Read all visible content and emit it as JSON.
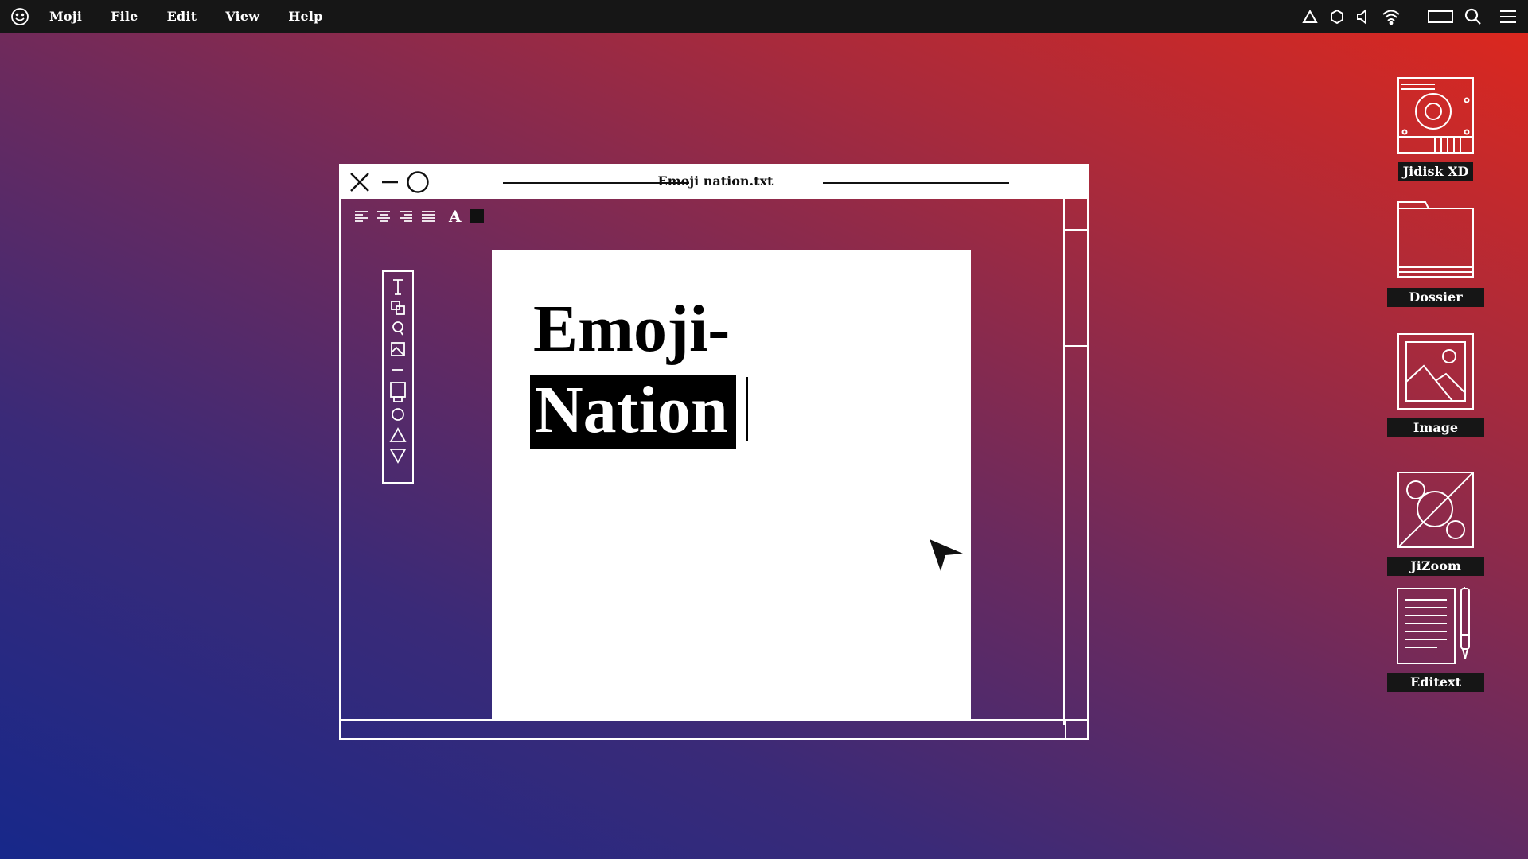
{
  "menubar": {
    "logo_icon": "smiley-icon",
    "items": [
      {
        "label": "Moji"
      },
      {
        "label": "File"
      },
      {
        "label": "Edit"
      },
      {
        "label": "View"
      },
      {
        "label": "Help"
      }
    ],
    "status_icons": [
      "triangle-icon",
      "hexagon-icon",
      "speaker-icon",
      "wifi-icon",
      "battery-icon",
      "search-icon",
      "hamburger-menu-icon"
    ]
  },
  "window": {
    "title": "Emoji nation.txt",
    "controls": [
      "close-icon",
      "minimize-icon",
      "maximize-icon"
    ],
    "format_bar": {
      "align_icons": [
        "align-left-icon",
        "align-center-icon",
        "align-right-icon",
        "align-justify-icon"
      ],
      "font_label": "A",
      "text_color": "#111111"
    },
    "tools": [
      "text-tool-icon",
      "layers-tool-icon",
      "lasso-tool-icon",
      "image-tool-icon",
      "line-tool-icon",
      "rectangle-tool-icon",
      "circle-tool-icon",
      "triangle-tool-icon",
      "inverted-triangle-tool-icon"
    ],
    "document": {
      "line1": "Emoji-",
      "line2_selected": "Nation"
    }
  },
  "desktop_icons": [
    {
      "label": "Jidisk XD",
      "icon": "hard-disk-icon"
    },
    {
      "label": "Dossier",
      "icon": "folder-icon"
    },
    {
      "label": "Image",
      "icon": "image-icon"
    },
    {
      "label": "JiZoom",
      "icon": "zoom-app-icon"
    },
    {
      "label": "Editext",
      "icon": "text-editor-icon"
    }
  ],
  "colors": {
    "menubar_bg": "#161616",
    "gradient_start": "#17288a",
    "gradient_end": "#e0281c"
  }
}
